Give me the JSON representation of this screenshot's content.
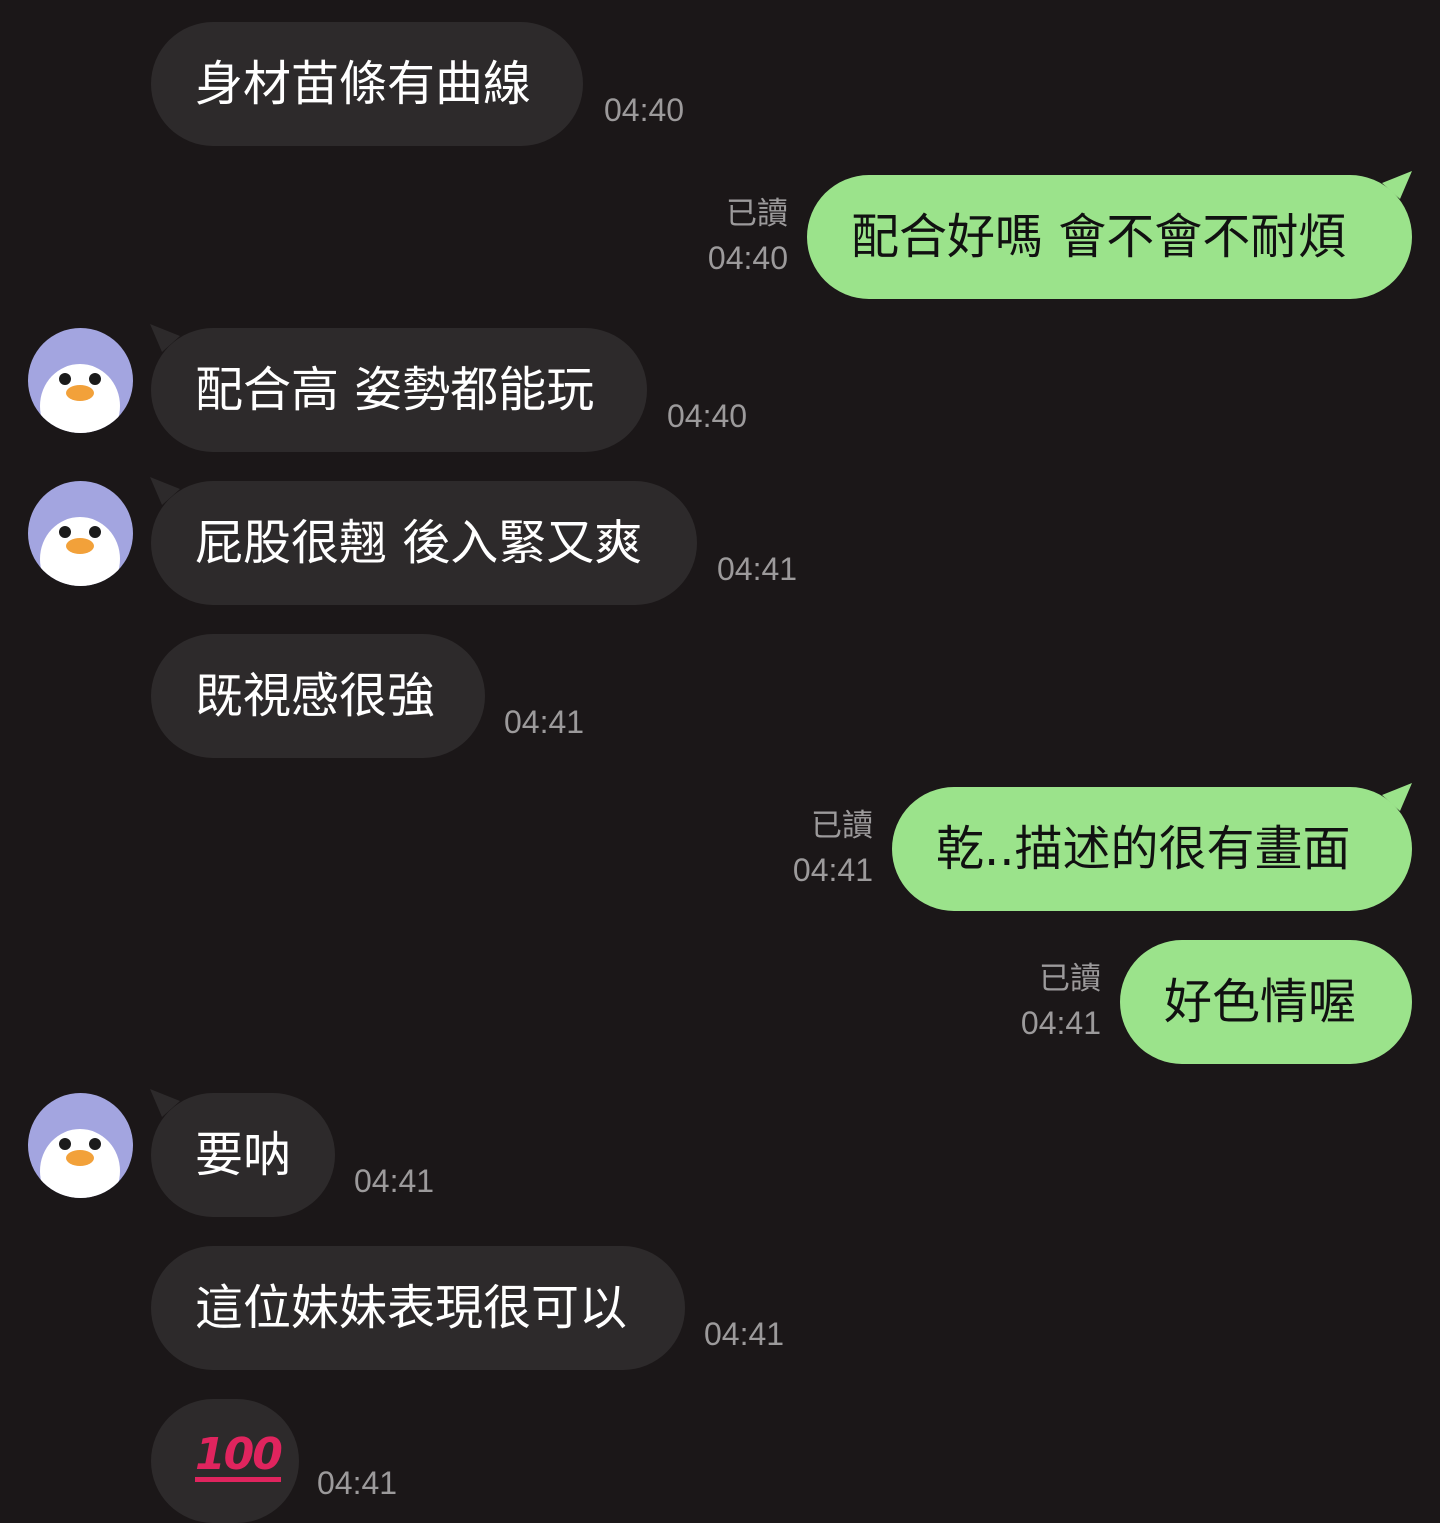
{
  "messages": [
    {
      "text": "身材苗條有曲線",
      "time": "04:40"
    },
    {
      "text": "配合好嗎 會不會不耐煩",
      "time": "04:40",
      "read": "已讀"
    },
    {
      "text": "配合高 姿勢都能玩",
      "time": "04:40"
    },
    {
      "text": "屁股很翹 後入緊又爽",
      "time": "04:41"
    },
    {
      "text": "既視感很強",
      "time": "04:41"
    },
    {
      "text": "乾..描述的很有畫面",
      "time": "04:41",
      "read": "已讀"
    },
    {
      "text": "好色情喔",
      "time": "04:41",
      "read": "已讀"
    },
    {
      "text": "要呐",
      "time": "04:41"
    },
    {
      "text": "這位妹妹表現很可以",
      "time": "04:41"
    },
    {
      "text": "💯",
      "time": "04:41"
    }
  ],
  "avatar_icon": "penguin-avatar-icon",
  "colors": {
    "background": "#1b1718",
    "incoming_bubble": "#2d2a2b",
    "outgoing_bubble": "#9be38b",
    "timestamp": "#9c9a9b",
    "avatar_bg": "#a3a5e0"
  }
}
